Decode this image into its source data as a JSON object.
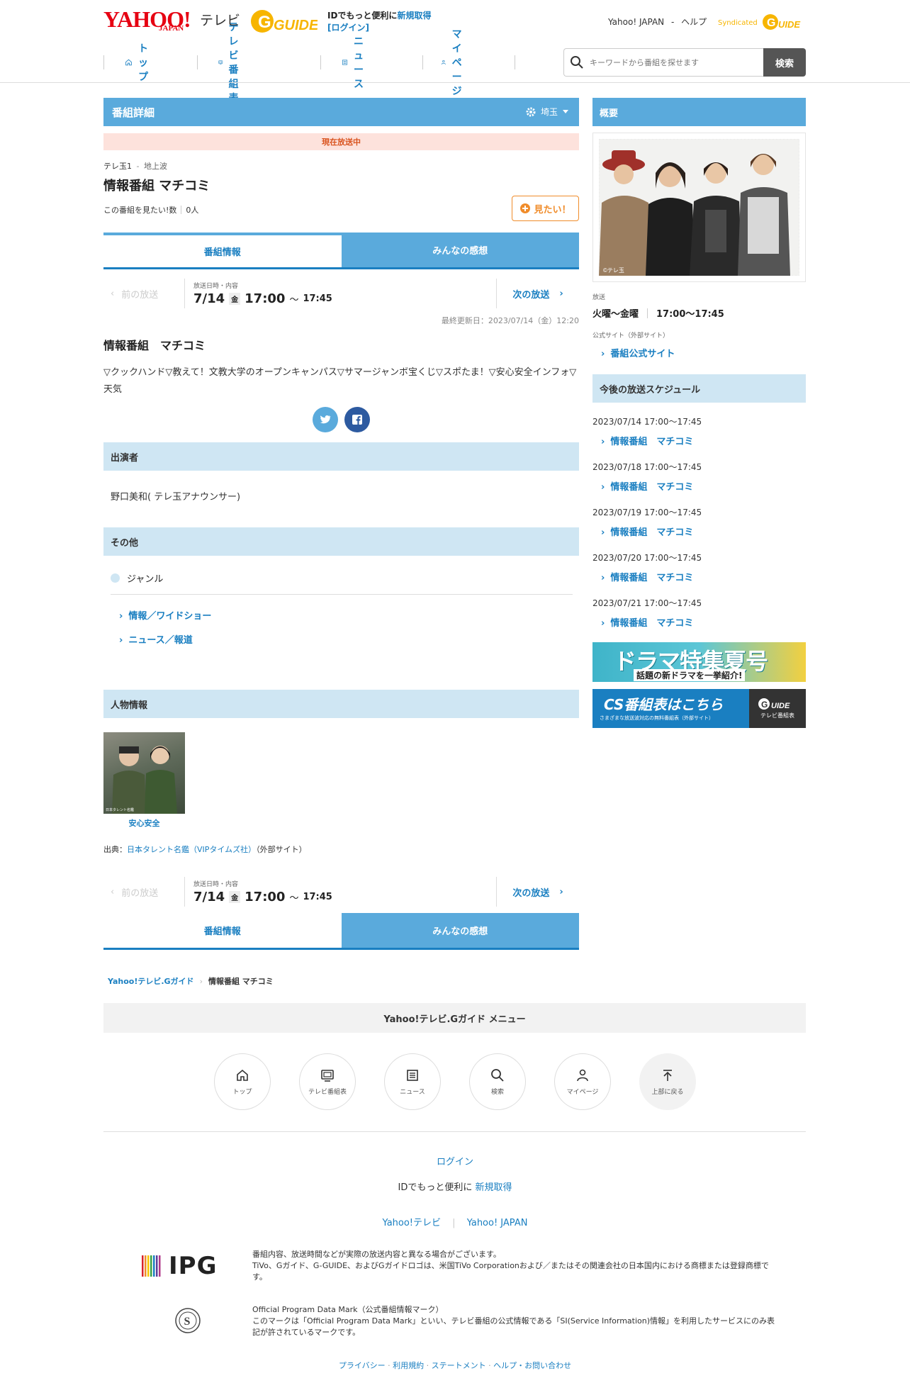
{
  "header": {
    "logo_yahoo": "YAHOO!",
    "logo_japan": "JAPAN",
    "logo_tv": "テレビ",
    "id_text": "IDでもっと便利に",
    "register": "新規取得",
    "login": "[ログイン]",
    "yahoo_japan": "Yahoo! JAPAN",
    "help": "ヘルプ",
    "syndicated": "Syndicated",
    "nav": [
      {
        "label": "トップ"
      },
      {
        "label": "テレビ番組表"
      },
      {
        "label": "ニュース"
      },
      {
        "label": "マイページ"
      }
    ],
    "search_placeholder": "キーワードから番組を探せます",
    "search_button": "検索"
  },
  "detail": {
    "title": "番組詳細",
    "region": "埼玉",
    "onair": "現在放送中",
    "channel": "テレ玉1",
    "channel_type": "地上波",
    "program": "情報番組 マチコミ",
    "want_label": "この番組を見たい!数",
    "want_count": "0人",
    "want_button": "見たい！",
    "tab1": "番組情報",
    "tab2": "みんなの感想",
    "prev": "前の放送",
    "next": "次の放送",
    "date_label": "放送日時・内容",
    "date": "7/14",
    "weekday": "金",
    "start": "17:00",
    "tilde": "〜",
    "end": "17:45",
    "updated": "最終更新日：2023/07/14（金）12:20",
    "program_title": "情報番組　マチコミ",
    "description": "▽クックハンド▽教えて！文教大学のオープンキャンパス▽サマージャンボ宝くじ▽スポたま！▽安心安全インフォ▽天気",
    "cast_header": "出演者",
    "cast": "野口美和( テレ玉アナウンサー)",
    "other_header": "その他",
    "genre_label": "ジャンル",
    "genres": [
      "情報／ワイドショー",
      "ニュース／報道"
    ],
    "person_header": "人物情報",
    "person_name": "安心安全",
    "person_caption": "日本タレント名鑑",
    "source_label": "出典：",
    "source_link": "日本タレント名鑑（VIPタイムズ社）",
    "source_ext": "（外部サイト）"
  },
  "sidebar": {
    "overview": "概要",
    "photo_credit": "©テレ玉",
    "broadcast_label": "放送",
    "days": "火曜〜金曜",
    "time": "17:00〜17:45",
    "official_label": "公式サイト（外部サイト）",
    "official_link": "番組公式サイト",
    "schedule_header": "今後の放送スケジュール",
    "schedule": [
      {
        "date": "2023/07/14 17:00〜17:45",
        "title": "情報番組　マチコミ"
      },
      {
        "date": "2023/07/18 17:00〜17:45",
        "title": "情報番組　マチコミ"
      },
      {
        "date": "2023/07/19 17:00〜17:45",
        "title": "情報番組　マチコミ"
      },
      {
        "date": "2023/07/20 17:00〜17:45",
        "title": "情報番組　マチコミ"
      },
      {
        "date": "2023/07/21 17:00〜17:45",
        "title": "情報番組　マチコミ"
      }
    ],
    "banner1_main": "ドラマ特集夏号",
    "banner1_sub": "話題の新ドラマを一挙紹介!",
    "banner2_main": "CS番組表はこちら",
    "banner2_sub": "さまざまな放送波対応の無料番組表（外部サイト）",
    "banner2_side": "テレビ番組表"
  },
  "breadcrumb": {
    "home": "Yahoo!テレビ.Gガイド",
    "current": "情報番組 マチコミ"
  },
  "footer": {
    "menu_title": "Yahoo!テレビ.Gガイド メニュー",
    "menu": [
      {
        "label": "トップ"
      },
      {
        "label": "テレビ番組表"
      },
      {
        "label": "ニュース"
      },
      {
        "label": "検索"
      },
      {
        "label": "マイページ"
      },
      {
        "label": "上部に戻る"
      }
    ],
    "login": "ログイン",
    "id_text": "IDでもっと便利に",
    "register": "新規取得",
    "yahoo_tv": "Yahoo!テレビ",
    "yahoo_japan": "Yahoo! JAPAN",
    "ipg_logo": "IPG",
    "notice1": "番組内容、放送時間などが実際の放送内容と異なる場合がございます。",
    "notice2": "TiVo、Gガイド、G-GUIDE、およびGガイドロゴは、米国TiVo Corporationおよび／またはその関連会社の日本国内における商標または登録商標です。",
    "mark_title": "Official Program Data Mark（公式番組情報マーク）",
    "mark_text": "このマークは「Official Program Data Mark」といい、テレビ番組の公式情報である「SI(Service Information)情報」を利用したサービスにのみ表記が許されているマークです。",
    "links": [
      "プライバシー",
      "利用規約",
      "ステートメント",
      "ヘルプ・お問い合わせ"
    ]
  }
}
